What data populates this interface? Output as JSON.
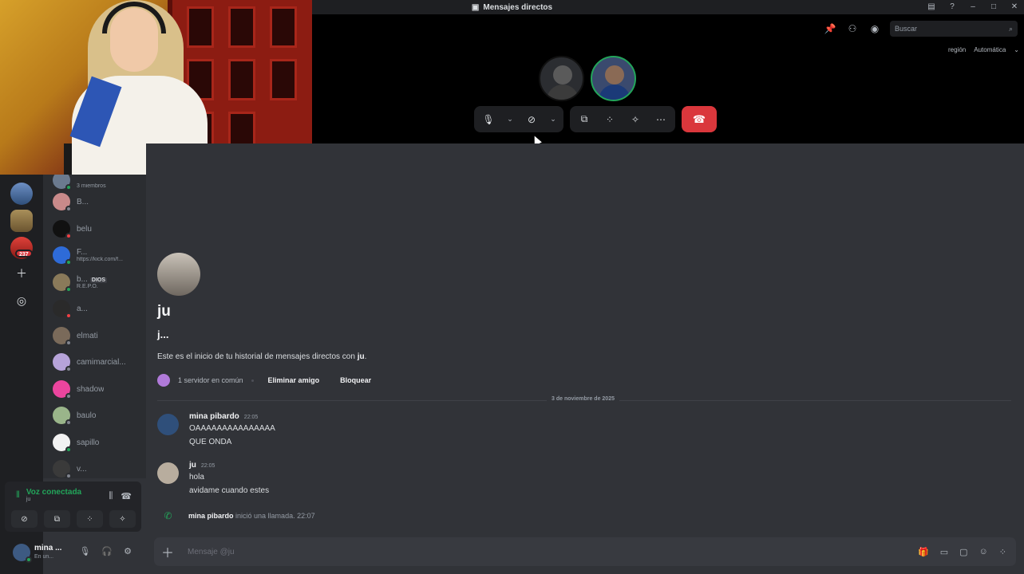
{
  "window": {
    "title": "Mensajes directos"
  },
  "call": {
    "search_placeholder": "Buscar",
    "region_label": "región",
    "region_value": "Automática"
  },
  "server_rail": {
    "badge": "237"
  },
  "dm_list": {
    "group_sub": "3 miembros",
    "items": [
      {
        "name": "B...",
        "sub": "",
        "tag": ""
      },
      {
        "name": "belu",
        "sub": "",
        "tag": ""
      },
      {
        "name": "F...",
        "sub": "https://kick.com/f...",
        "tag": ""
      },
      {
        "name": "b...",
        "sub": "R.E.P.O.",
        "tag": "DIOS"
      },
      {
        "name": "a...",
        "sub": "",
        "tag": ""
      },
      {
        "name": "elmati",
        "sub": "",
        "tag": ""
      },
      {
        "name": "camimarcial...",
        "sub": "",
        "tag": ""
      },
      {
        "name": "shadow",
        "sub": "",
        "tag": ""
      },
      {
        "name": "baulo",
        "sub": "",
        "tag": ""
      },
      {
        "name": "sapillo",
        "sub": "",
        "tag": ""
      },
      {
        "name": "v...",
        "sub": "",
        "tag": ""
      }
    ]
  },
  "voice": {
    "title": "Voz conectada",
    "channel": "ju"
  },
  "user": {
    "name": "mina ...",
    "status": "En un..."
  },
  "chat": {
    "intro_name": "ju",
    "intro_username": "j...",
    "intro_text_prefix": "Este es el inicio de tu historial de mensajes directos con ",
    "intro_text_name": "ju",
    "intro_text_suffix": ".",
    "mutual_servers": "1 servidor en común",
    "remove_friend": "Eliminar amigo",
    "block": "Bloquear",
    "date_divider": "3 de noviembre de 2025",
    "messages": [
      {
        "author": "mina pibardo",
        "time": "22:05",
        "lines": [
          "OAAAAAAAAAAAAAAA",
          "QUE ONDA"
        ]
      },
      {
        "author": "ju",
        "time": "22:05",
        "lines": [
          "hola",
          "avidame cuando estes"
        ]
      }
    ],
    "system_message": {
      "author": "mina pibardo",
      "text": "inició una llamada.",
      "time": "22:07"
    },
    "composer_placeholder": "Mensaje @ju"
  }
}
